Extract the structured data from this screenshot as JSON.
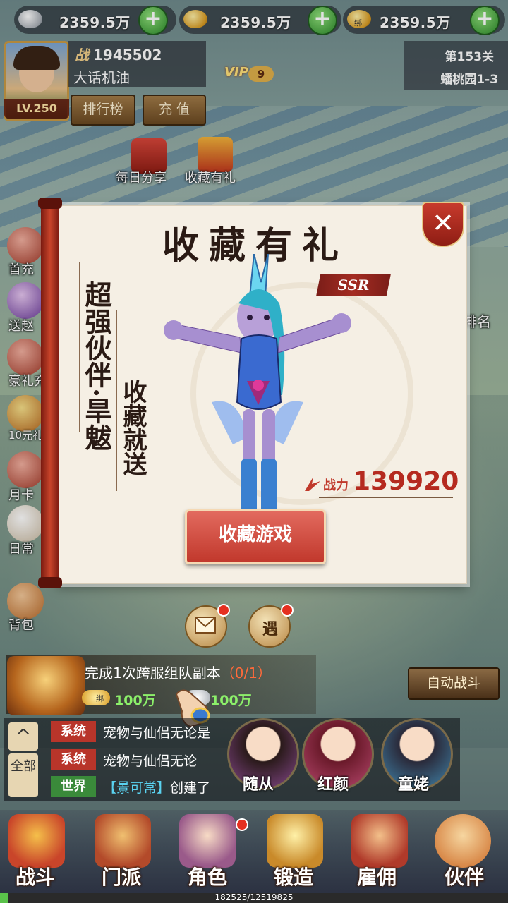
{
  "currency": [
    {
      "value": "2359.5万",
      "icon": "silver-ingot-icon",
      "bound": ""
    },
    {
      "value": "2359.5万",
      "icon": "gold-ingot-icon",
      "bound": ""
    },
    {
      "value": "2359.5万",
      "icon": "bound-gold-icon",
      "bound": "绑"
    }
  ],
  "player": {
    "power_prefix": "战",
    "power": "1945502",
    "name": "大话机油",
    "level": "LV.250",
    "vip_label": "VIP",
    "vip_level": "9"
  },
  "buttons": {
    "ranking": "排行榜",
    "recharge": "充 值",
    "auto_battle": "自动战斗",
    "close": "✕",
    "collect_game": "收藏游戏",
    "chat_up": "^",
    "chat_all": "全部"
  },
  "stage": {
    "number": "第153关",
    "name": "蟠桃园1-3"
  },
  "top_icons": [
    {
      "label": "每日分享"
    },
    {
      "label": "收藏有礼"
    }
  ],
  "left_column": [
    "首充",
    "送赵",
    "豪礼充",
    "10元礼",
    "月卡",
    "日常",
    "背包"
  ],
  "right_column": [
    "排名"
  ],
  "modal": {
    "title": "收藏有礼",
    "rarity": "SSR",
    "slogan_1": "超强伙伴·旱魃",
    "slogan_2": "收藏就送",
    "power_label": "战力",
    "power_value": "139920"
  },
  "mid_buttons": [
    {
      "label": "",
      "icon": "mail-icon"
    },
    {
      "label": "遇",
      "icon": "encounter-icon"
    }
  ],
  "quest": {
    "text": "完成1次跨服组队副本",
    "progress": "（0/1）",
    "reward_1": "100万",
    "reward_2": "100万",
    "bound_tag": "绑"
  },
  "chat": [
    {
      "channel": "系统",
      "message": "宠物与仙侣无论是",
      "name": "",
      "channel_color": "#b8352a"
    },
    {
      "channel": "系统",
      "message": "宠物与仙侣无论",
      "name": "",
      "channel_color": "#b8352a"
    },
    {
      "channel": "世界",
      "message": "创建了",
      "name": "【景可常】",
      "channel_color": "#3a8a3a"
    }
  ],
  "companions": [
    {
      "label": "随从"
    },
    {
      "label": "红颜"
    },
    {
      "label": "童姥"
    }
  ],
  "nav": [
    {
      "label": "战斗",
      "color": "#c9452a"
    },
    {
      "label": "门派",
      "color": "#b34a2a"
    },
    {
      "label": "角色",
      "color": "#9a5a8a"
    },
    {
      "label": "锻造",
      "color": "#c98a2a"
    },
    {
      "label": "雇佣",
      "color": "#b03a2a"
    },
    {
      "label": "伙伴",
      "color": "#d98a4a"
    }
  ],
  "exp": {
    "text": "182525/12519825",
    "fraction": 0.0146
  }
}
